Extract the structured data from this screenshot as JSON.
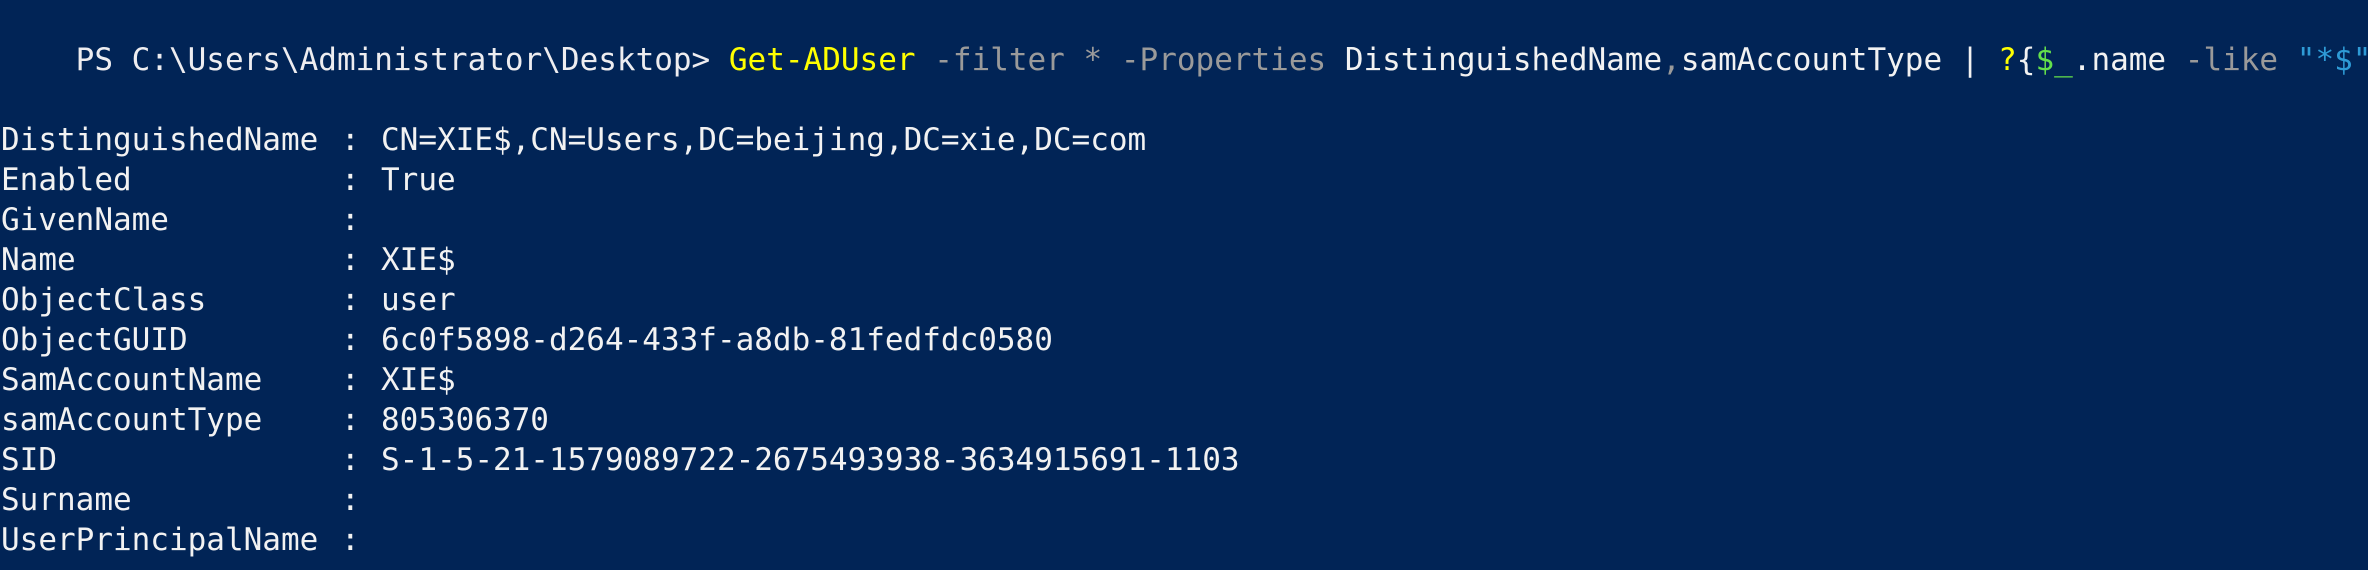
{
  "console": {
    "prompt": "PS C:\\Users\\Administrator\\Desktop> ",
    "command_tokens": [
      {
        "text": "Get-ADUser",
        "kind": "command"
      },
      {
        "text": " ",
        "kind": "default"
      },
      {
        "text": "-filter",
        "kind": "param"
      },
      {
        "text": " ",
        "kind": "default"
      },
      {
        "text": "*",
        "kind": "param"
      },
      {
        "text": " ",
        "kind": "default"
      },
      {
        "text": "-Properties",
        "kind": "param"
      },
      {
        "text": " DistinguishedName",
        "kind": "text"
      },
      {
        "text": ",",
        "kind": "op"
      },
      {
        "text": "samAccountType",
        "kind": "text"
      },
      {
        "text": " | ",
        "kind": "text"
      },
      {
        "text": "?",
        "kind": "command"
      },
      {
        "text": "{",
        "kind": "text"
      },
      {
        "text": "$_",
        "kind": "var"
      },
      {
        "text": ".name",
        "kind": "text"
      },
      {
        "text": " ",
        "kind": "default"
      },
      {
        "text": "-like",
        "kind": "param"
      },
      {
        "text": " ",
        "kind": "default"
      },
      {
        "text": "\"*$\"",
        "kind": "string"
      },
      {
        "text": "}",
        "kind": "text"
      }
    ],
    "separator": ":",
    "properties": [
      {
        "name": "DistinguishedName",
        "value": "CN=XIE$,CN=Users,DC=beijing,DC=xie,DC=com"
      },
      {
        "name": "Enabled",
        "value": "True"
      },
      {
        "name": "GivenName",
        "value": ""
      },
      {
        "name": "Name",
        "value": "XIE$"
      },
      {
        "name": "ObjectClass",
        "value": "user"
      },
      {
        "name": "ObjectGUID",
        "value": "6c0f5898-d264-433f-a8db-81fedfdc0580"
      },
      {
        "name": "SamAccountName",
        "value": "XIE$"
      },
      {
        "name": "samAccountType",
        "value": "805306370"
      },
      {
        "name": "SID",
        "value": "S-1-5-21-1579089722-2675493938-3634915691-1103"
      },
      {
        "name": "Surname",
        "value": ""
      },
      {
        "name": "UserPrincipalName",
        "value": ""
      }
    ]
  },
  "colors": {
    "background": "#012456",
    "command": "#ffff00",
    "parameter": "#9a9a9a",
    "variable": "#64e04b",
    "string": "#2e9bd6",
    "text": "#f2f2f2"
  }
}
